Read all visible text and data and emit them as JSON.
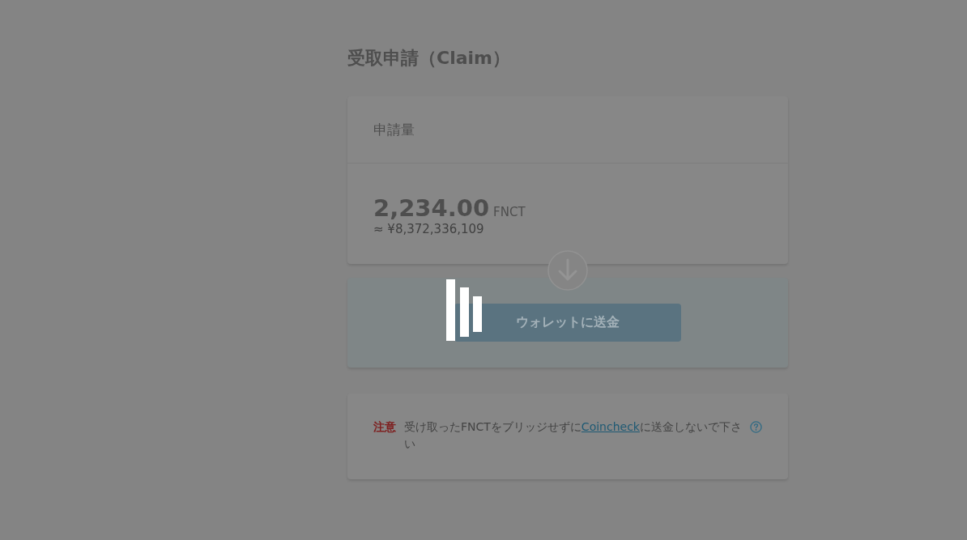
{
  "title": "受取申請（Claim）",
  "amount_card": {
    "label": "申請量",
    "amount": "2,234.00",
    "unit": "FNCT",
    "fiat_estimate": "≈ ¥8,372,336,109"
  },
  "send_card": {
    "button": {
      "label": "ウォレットに送金"
    }
  },
  "notice": {
    "label": "注意",
    "text_before": "受け取ったFNCTをブリッジせずに",
    "link": "Coincheck",
    "text_after": "に送金しないで下さい"
  },
  "loading": true
}
